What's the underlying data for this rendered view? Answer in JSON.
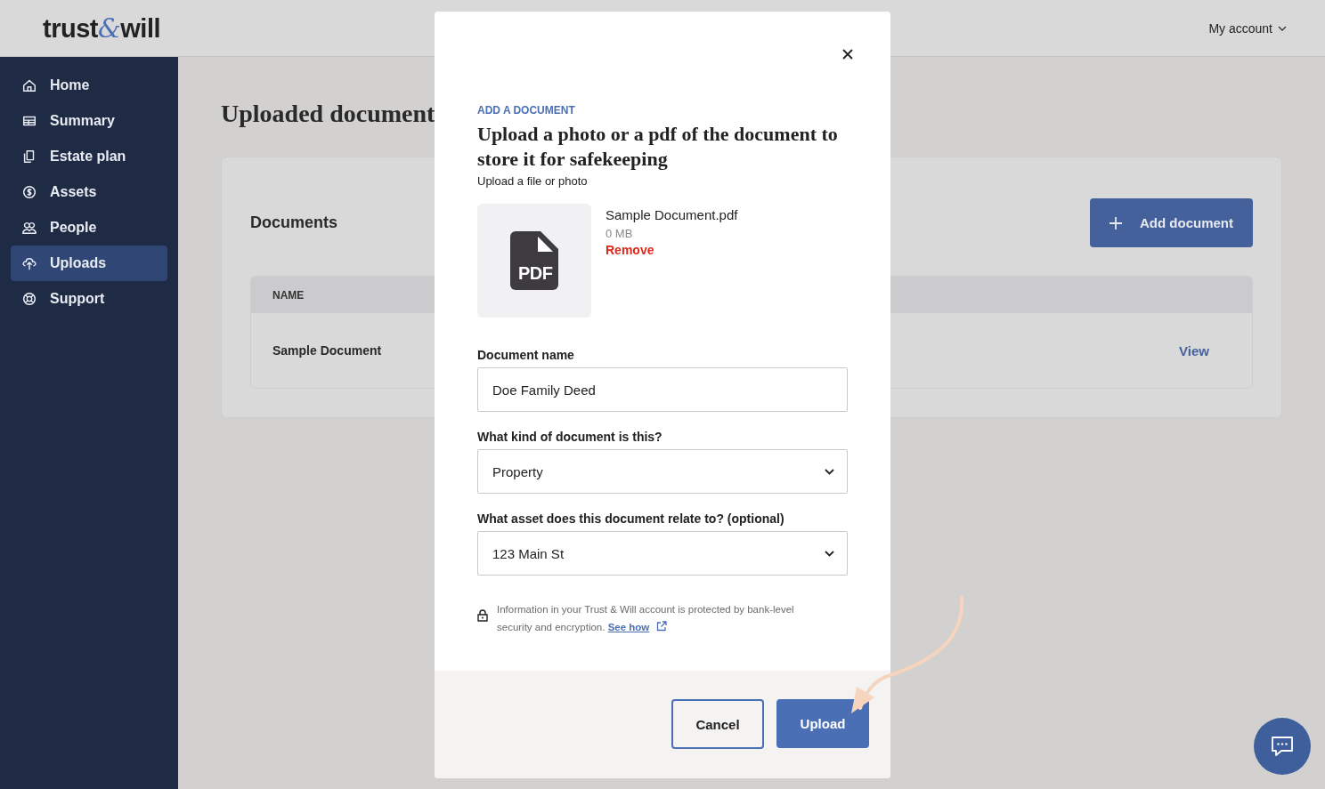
{
  "logo": [
    {
      "text": "trust",
      "accent": false
    },
    {
      "text": "&",
      "accent": true
    },
    {
      "text": "will",
      "accent": false
    }
  ],
  "account_menu": {
    "label": "My account"
  },
  "sidebar": {
    "items": [
      {
        "label": "Home",
        "selected": false
      },
      {
        "label": "Summary",
        "selected": false
      },
      {
        "label": "Estate plan",
        "selected": false
      },
      {
        "label": "Assets",
        "selected": false
      },
      {
        "label": "People",
        "selected": false
      },
      {
        "label": "Uploads",
        "selected": true
      },
      {
        "label": "Support",
        "selected": false
      }
    ]
  },
  "page": {
    "title": "Uploaded document",
    "section_title": "Documents",
    "add_button": "Add document",
    "table": {
      "columns": [
        "NAME"
      ],
      "rows": [
        {
          "name": "Sample Document",
          "action": "View"
        }
      ]
    }
  },
  "modal": {
    "eyebrow": "ADD A DOCUMENT",
    "title": "Upload a photo or a pdf of the document to store it for safekeeping",
    "subtitle": "Upload a file or photo",
    "file": {
      "badge": "PDF",
      "name": "Sample Document.pdf",
      "size": "0 MB",
      "remove": "Remove"
    },
    "fields": [
      {
        "kind": "text",
        "label": "Document name",
        "value": "Doe Family Deed"
      },
      {
        "kind": "select",
        "label": "What kind of document is this?",
        "value": "Property"
      },
      {
        "kind": "select",
        "label": "What asset does this document relate to? (optional)",
        "value": "123 Main St"
      }
    ],
    "security_note": "Information in your Trust & Will account is protected by bank-level security and encryption.",
    "security_link": "See how",
    "buttons": [
      {
        "kind": "secondary",
        "label": "Cancel"
      },
      {
        "kind": "primary",
        "label": "Upload"
      }
    ]
  }
}
